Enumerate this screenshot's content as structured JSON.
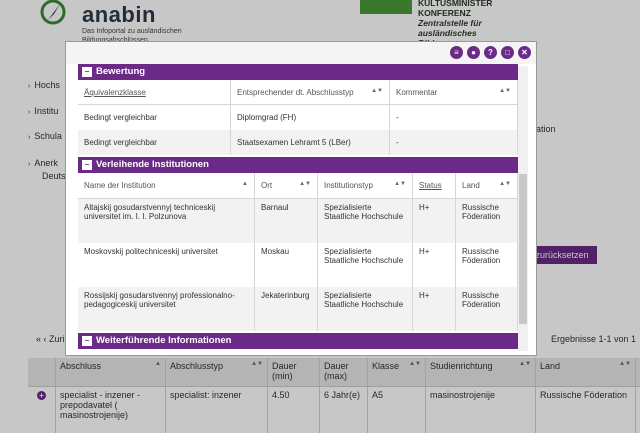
{
  "header": {
    "brand": "anabin",
    "brand_sub": "Das Infoportal zu ausländischen Bildungsabschlüssen",
    "kmk_title": "KULTUSMINISTER KONFERENZ",
    "kmk_sub": "Zentralstelle für ausländisches Bildungswesen"
  },
  "bg_nav": [
    {
      "label": "Hochs"
    },
    {
      "label": "Institu"
    },
    {
      "label": "Schula"
    },
    {
      "label": "Anerk"
    },
    {
      "label": "Deuts"
    }
  ],
  "bg_misc": {
    "reset_label": "zurücksetzen",
    "ergebnisse": "Ergebnisse 1-1 von 1",
    "prev": "« ‹ Zuri",
    "m": "n",
    "ration": "eration"
  },
  "bottom_table": {
    "headers": [
      "Abschluss",
      "Abschlusstyp",
      "Dauer (min)",
      "Dauer (max)",
      "Klasse",
      "Studienrichtung",
      "Land"
    ],
    "row": [
      "specialist - inzener - prepodavatel ( masinostrojenije)",
      "specialist: inzener",
      "4.50",
      "6 Jahr(e)",
      "A5",
      "masinostrojenije",
      "Russische Föderation"
    ]
  },
  "modal": {
    "bewertung": {
      "title": "Bewertung",
      "headers": [
        "Äquivalenzklasse",
        "Entsprechender dt. Abschlusstyp",
        "Kommentar"
      ],
      "rows": [
        [
          "Bedingt vergleichbar",
          "Diplomgrad (FH)",
          "-"
        ],
        [
          "Bedingt vergleichbar",
          "Staatsexamen Lehramt 5 (LBer)",
          "-"
        ]
      ]
    },
    "institutionen": {
      "title": "Verleihende Institutionen",
      "headers": [
        "Name der Institution",
        "Ort",
        "Institutionstyp",
        "Status",
        "Land"
      ],
      "rows": [
        [
          "Altajskij gosudarstvennyj techniceskij universitet im. I. I. Polzunova",
          "Barnaul",
          "Spezialisierte Staatliche Hochschule",
          "H+",
          "Russische Föderation"
        ],
        [
          "Moskovskij politechniceskij universitet",
          "Moskau",
          "Spezialisierte Staatliche Hochschule",
          "H+",
          "Russische Föderation"
        ],
        [
          "Rossijskij gosudarstvennyj professionalno-pedagogiceskij universitet",
          "Jekaterinburg",
          "Spezialisierte Staatliche Hochschule",
          "H+",
          "Russische Föderation"
        ]
      ]
    },
    "weiter": {
      "title": "Weiterführende Informationen"
    }
  }
}
